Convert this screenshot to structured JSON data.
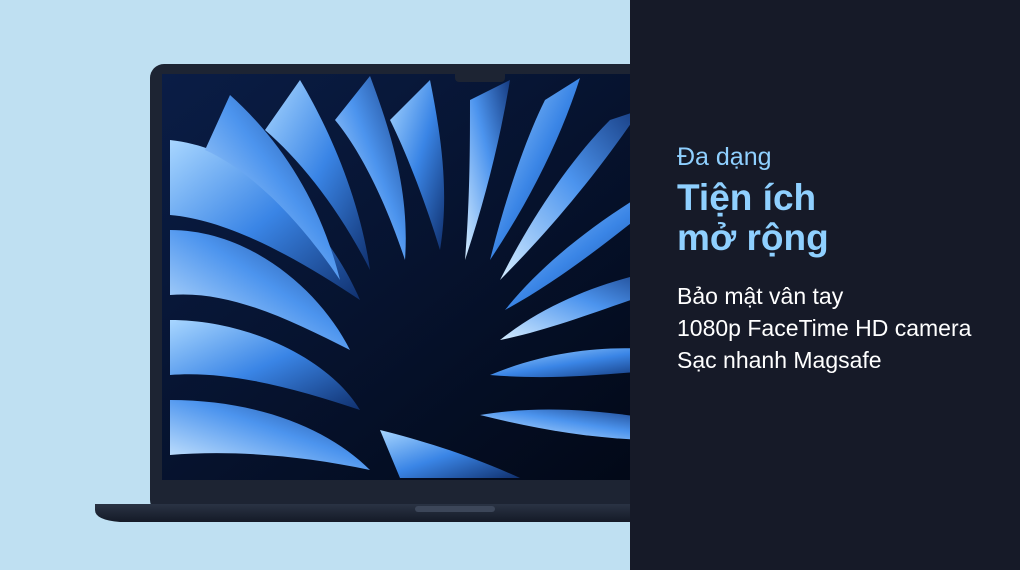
{
  "colors": {
    "left_background": "#bfe0f2",
    "right_background": "#161a28",
    "accent_text": "#8fd0ff",
    "feature_text": "#ffffff",
    "laptop_body": "#1d2433",
    "screen_dark": "#050a1c",
    "screen_blue": "#2f79d8",
    "screen_light": "#8ec8ff"
  },
  "promo": {
    "kicker": "Đa dạng",
    "headline_line1": "Tiện ích",
    "headline_line2": "mở rộng",
    "features": [
      "Bảo mật vân tay",
      "1080p FaceTime HD camera",
      "Sạc nhanh Magsafe"
    ]
  },
  "image": {
    "subject": "laptop-with-blue-abstract-wallpaper"
  }
}
